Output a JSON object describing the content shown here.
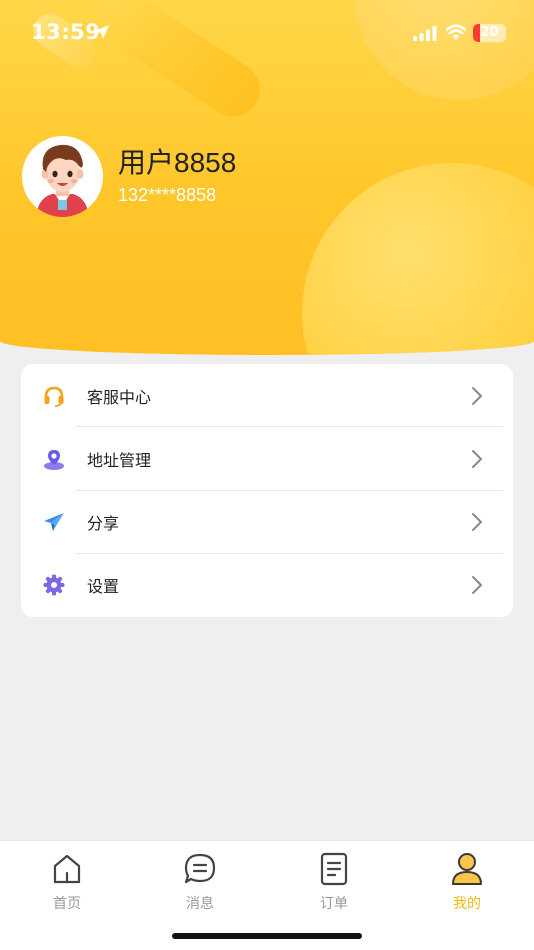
{
  "status": {
    "time": "13:59",
    "battery": "20"
  },
  "profile": {
    "name": "用户8858",
    "phone": "132****8858"
  },
  "menu": [
    {
      "label": "客服中心",
      "icon": "headset-icon"
    },
    {
      "label": "地址管理",
      "icon": "location-pin-icon"
    },
    {
      "label": "分享",
      "icon": "paper-plane-icon"
    },
    {
      "label": "设置",
      "icon": "gear-icon"
    }
  ],
  "tabs": [
    {
      "label": "首页",
      "icon": "home-icon",
      "active": false
    },
    {
      "label": "消息",
      "icon": "message-icon",
      "active": false
    },
    {
      "label": "订单",
      "icon": "order-icon",
      "active": false
    },
    {
      "label": "我的",
      "icon": "user-icon",
      "active": true
    }
  ],
  "colors": {
    "accent": "#f8b916",
    "header": "#ffc62a"
  }
}
